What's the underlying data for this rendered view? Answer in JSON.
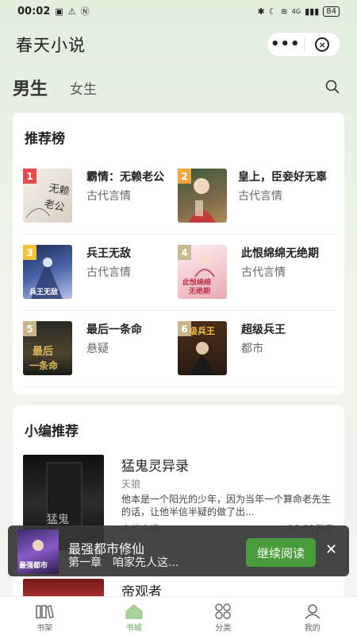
{
  "status": {
    "time": "00:02",
    "network": "4G",
    "battery": "84"
  },
  "app": {
    "title": "春天小说"
  },
  "tabs": {
    "male": "男生",
    "female": "女生"
  },
  "ranking": {
    "title": "推荐榜",
    "items": [
      {
        "rank": "1",
        "name": "霸情：无赖老公",
        "genre": "古代言情",
        "badge_color": "#e84b4b"
      },
      {
        "rank": "2",
        "name": "皇上，臣妾好无辜",
        "genre": "古代言情",
        "badge_color": "#f0a742"
      },
      {
        "rank": "3",
        "name": "兵王无敌",
        "genre": "古代言情",
        "badge_color": "#f2c43d"
      },
      {
        "rank": "4",
        "name": "此恨绵绵无绝期",
        "genre": "古代言情",
        "badge_color": "#c7b98f"
      },
      {
        "rank": "5",
        "name": "最后一条命",
        "genre": "悬疑",
        "badge_color": "#c9b58a"
      },
      {
        "rank": "6",
        "name": "超级兵王",
        "genre": "都市",
        "badge_color": "#c9b58a"
      }
    ]
  },
  "picks": {
    "title": "小编推荐",
    "book1": {
      "title": "猛鬼灵异录",
      "author": "天狼",
      "desc": "他本是一个阳光的少年，因为当年一个算命老先生的话，让他半信半疑的做了出...",
      "genre": "古代言情",
      "words": "16.03万字"
    },
    "book2": {
      "title": "帝观者"
    }
  },
  "continue": {
    "title": "最强都市修仙",
    "chapter": "第一章　咱家先人这...",
    "button": "继续阅读"
  },
  "nav": {
    "shelf": "书架",
    "store": "书城",
    "category": "分类",
    "mine": "我的"
  },
  "colors": {
    "accent": "#4a9b3c",
    "nav_active": "#66a85a"
  }
}
